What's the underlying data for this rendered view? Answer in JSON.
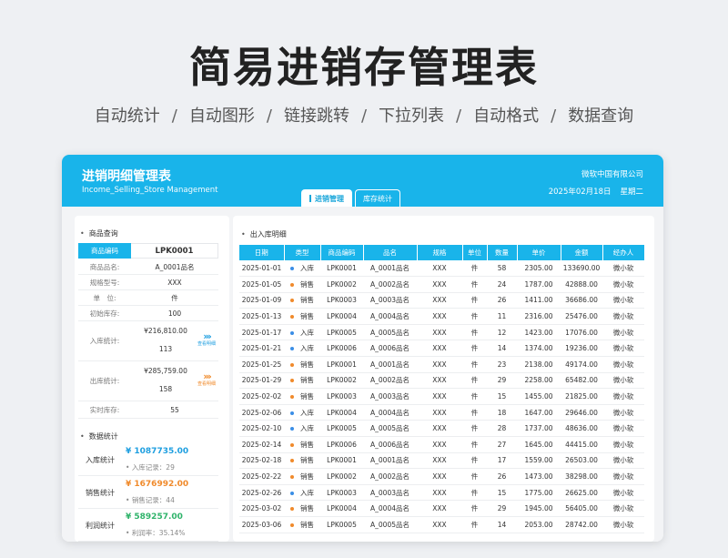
{
  "hero": {
    "title": "简易进销存管理表",
    "features": [
      "自动统计",
      "自动图形",
      "链接跳转",
      "下拉列表",
      "自动格式",
      "数据查询"
    ]
  },
  "header": {
    "title": "进销明细管理表",
    "subtitle": "Income_Selling_Store Management",
    "company": "微软中国有限公司",
    "date": "2025年02月18日",
    "weekday": "星期二",
    "tabs": [
      "进销管理",
      "库存统计"
    ]
  },
  "colors": {
    "accent": "#19b4ea",
    "in_dot": "#3a8ee6",
    "out_dot": "#f08a2b",
    "profit": "#2fb36a"
  },
  "product": {
    "section_title": "商品查询",
    "code_label": "商品编码",
    "code_value": "LPK0001",
    "name_label": "商品品名:",
    "name_value": "A_0001品名",
    "spec_label": "规格型号:",
    "spec_value": "XXX",
    "unit_label": "单　位:",
    "unit_value": "件",
    "initial_label": "初始库存:",
    "initial_value": "100",
    "in_label": "入库统计:",
    "in_amount": "¥216,810.00",
    "in_qty": "113",
    "in_link": "查看明细",
    "out_label": "出库统计:",
    "out_amount": "¥285,759.00",
    "out_qty": "158",
    "out_link": "查看明细",
    "stock_label": "实时库存:",
    "stock_value": "55"
  },
  "stats": {
    "section_title": "数据统计",
    "in_label": "入库统计",
    "in_value": "¥ 1087735.00",
    "in_sub": "入库记录：29",
    "sales_label": "销售统计",
    "sales_value": "¥ 1676992.00",
    "sales_sub": "销售记录：44",
    "profit_label": "利润统计",
    "profit_value": "¥ 589257.00",
    "profit_sub": "利润率：35.14%"
  },
  "ledger": {
    "section_title": "出入库明细",
    "columns": [
      "日期",
      "类型",
      "商品编码",
      "品名",
      "规格",
      "单位",
      "数量",
      "单价",
      "金额",
      "经办人"
    ],
    "rows": [
      {
        "date": "2025-01-01",
        "kind": "in",
        "type": "入库",
        "code": "LPK0001",
        "name": "A_0001品名",
        "spec": "XXX",
        "unit": "件",
        "qty": "58",
        "price": "2305.00",
        "amount": "133690.00",
        "handler": "微小软"
      },
      {
        "date": "2025-01-05",
        "kind": "out",
        "type": "销售",
        "code": "LPK0002",
        "name": "A_0002品名",
        "spec": "XXX",
        "unit": "件",
        "qty": "24",
        "price": "1787.00",
        "amount": "42888.00",
        "handler": "微小软"
      },
      {
        "date": "2025-01-09",
        "kind": "out",
        "type": "销售",
        "code": "LPK0003",
        "name": "A_0003品名",
        "spec": "XXX",
        "unit": "件",
        "qty": "26",
        "price": "1411.00",
        "amount": "36686.00",
        "handler": "微小软"
      },
      {
        "date": "2025-01-13",
        "kind": "out",
        "type": "销售",
        "code": "LPK0004",
        "name": "A_0004品名",
        "spec": "XXX",
        "unit": "件",
        "qty": "11",
        "price": "2316.00",
        "amount": "25476.00",
        "handler": "微小软"
      },
      {
        "date": "2025-01-17",
        "kind": "in",
        "type": "入库",
        "code": "LPK0005",
        "name": "A_0005品名",
        "spec": "XXX",
        "unit": "件",
        "qty": "12",
        "price": "1423.00",
        "amount": "17076.00",
        "handler": "微小软"
      },
      {
        "date": "2025-01-21",
        "kind": "in",
        "type": "入库",
        "code": "LPK0006",
        "name": "A_0006品名",
        "spec": "XXX",
        "unit": "件",
        "qty": "14",
        "price": "1374.00",
        "amount": "19236.00",
        "handler": "微小软"
      },
      {
        "date": "2025-01-25",
        "kind": "out",
        "type": "销售",
        "code": "LPK0001",
        "name": "A_0001品名",
        "spec": "XXX",
        "unit": "件",
        "qty": "23",
        "price": "2138.00",
        "amount": "49174.00",
        "handler": "微小软"
      },
      {
        "date": "2025-01-29",
        "kind": "out",
        "type": "销售",
        "code": "LPK0002",
        "name": "A_0002品名",
        "spec": "XXX",
        "unit": "件",
        "qty": "29",
        "price": "2258.00",
        "amount": "65482.00",
        "handler": "微小软"
      },
      {
        "date": "2025-02-02",
        "kind": "out",
        "type": "销售",
        "code": "LPK0003",
        "name": "A_0003品名",
        "spec": "XXX",
        "unit": "件",
        "qty": "15",
        "price": "1455.00",
        "amount": "21825.00",
        "handler": "微小软"
      },
      {
        "date": "2025-02-06",
        "kind": "in",
        "type": "入库",
        "code": "LPK0004",
        "name": "A_0004品名",
        "spec": "XXX",
        "unit": "件",
        "qty": "18",
        "price": "1647.00",
        "amount": "29646.00",
        "handler": "微小软"
      },
      {
        "date": "2025-02-10",
        "kind": "in",
        "type": "入库",
        "code": "LPK0005",
        "name": "A_0005品名",
        "spec": "XXX",
        "unit": "件",
        "qty": "28",
        "price": "1737.00",
        "amount": "48636.00",
        "handler": "微小软"
      },
      {
        "date": "2025-02-14",
        "kind": "out",
        "type": "销售",
        "code": "LPK0006",
        "name": "A_0006品名",
        "spec": "XXX",
        "unit": "件",
        "qty": "27",
        "price": "1645.00",
        "amount": "44415.00",
        "handler": "微小软"
      },
      {
        "date": "2025-02-18",
        "kind": "out",
        "type": "销售",
        "code": "LPK0001",
        "name": "A_0001品名",
        "spec": "XXX",
        "unit": "件",
        "qty": "17",
        "price": "1559.00",
        "amount": "26503.00",
        "handler": "微小软"
      },
      {
        "date": "2025-02-22",
        "kind": "out",
        "type": "销售",
        "code": "LPK0002",
        "name": "A_0002品名",
        "spec": "XXX",
        "unit": "件",
        "qty": "26",
        "price": "1473.00",
        "amount": "38298.00",
        "handler": "微小软"
      },
      {
        "date": "2025-02-26",
        "kind": "in",
        "type": "入库",
        "code": "LPK0003",
        "name": "A_0003品名",
        "spec": "XXX",
        "unit": "件",
        "qty": "15",
        "price": "1775.00",
        "amount": "26625.00",
        "handler": "微小软"
      },
      {
        "date": "2025-03-02",
        "kind": "out",
        "type": "销售",
        "code": "LPK0004",
        "name": "A_0004品名",
        "spec": "XXX",
        "unit": "件",
        "qty": "29",
        "price": "1945.00",
        "amount": "56405.00",
        "handler": "微小软"
      },
      {
        "date": "2025-03-06",
        "kind": "out",
        "type": "销售",
        "code": "LPK0005",
        "name": "A_0005品名",
        "spec": "XXX",
        "unit": "件",
        "qty": "14",
        "price": "2053.00",
        "amount": "28742.00",
        "handler": "微小软"
      }
    ]
  }
}
